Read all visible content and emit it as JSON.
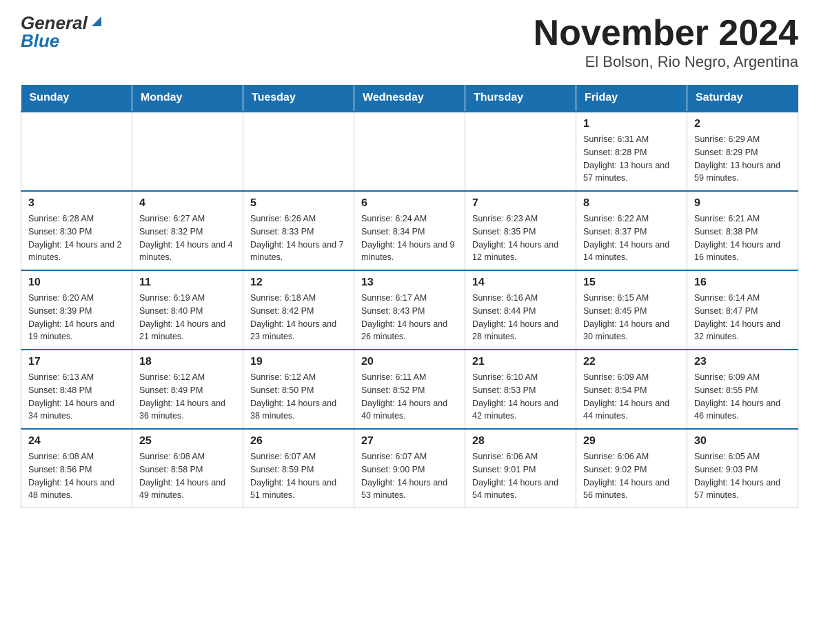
{
  "header": {
    "logo_line1": "General",
    "logo_line2": "Blue",
    "title": "November 2024",
    "subtitle": "El Bolson, Rio Negro, Argentina"
  },
  "days_of_week": [
    "Sunday",
    "Monday",
    "Tuesday",
    "Wednesday",
    "Thursday",
    "Friday",
    "Saturday"
  ],
  "weeks": [
    [
      {
        "day": "",
        "info": ""
      },
      {
        "day": "",
        "info": ""
      },
      {
        "day": "",
        "info": ""
      },
      {
        "day": "",
        "info": ""
      },
      {
        "day": "",
        "info": ""
      },
      {
        "day": "1",
        "info": "Sunrise: 6:31 AM\nSunset: 8:28 PM\nDaylight: 13 hours and 57 minutes."
      },
      {
        "day": "2",
        "info": "Sunrise: 6:29 AM\nSunset: 8:29 PM\nDaylight: 13 hours and 59 minutes."
      }
    ],
    [
      {
        "day": "3",
        "info": "Sunrise: 6:28 AM\nSunset: 8:30 PM\nDaylight: 14 hours and 2 minutes."
      },
      {
        "day": "4",
        "info": "Sunrise: 6:27 AM\nSunset: 8:32 PM\nDaylight: 14 hours and 4 minutes."
      },
      {
        "day": "5",
        "info": "Sunrise: 6:26 AM\nSunset: 8:33 PM\nDaylight: 14 hours and 7 minutes."
      },
      {
        "day": "6",
        "info": "Sunrise: 6:24 AM\nSunset: 8:34 PM\nDaylight: 14 hours and 9 minutes."
      },
      {
        "day": "7",
        "info": "Sunrise: 6:23 AM\nSunset: 8:35 PM\nDaylight: 14 hours and 12 minutes."
      },
      {
        "day": "8",
        "info": "Sunrise: 6:22 AM\nSunset: 8:37 PM\nDaylight: 14 hours and 14 minutes."
      },
      {
        "day": "9",
        "info": "Sunrise: 6:21 AM\nSunset: 8:38 PM\nDaylight: 14 hours and 16 minutes."
      }
    ],
    [
      {
        "day": "10",
        "info": "Sunrise: 6:20 AM\nSunset: 8:39 PM\nDaylight: 14 hours and 19 minutes."
      },
      {
        "day": "11",
        "info": "Sunrise: 6:19 AM\nSunset: 8:40 PM\nDaylight: 14 hours and 21 minutes."
      },
      {
        "day": "12",
        "info": "Sunrise: 6:18 AM\nSunset: 8:42 PM\nDaylight: 14 hours and 23 minutes."
      },
      {
        "day": "13",
        "info": "Sunrise: 6:17 AM\nSunset: 8:43 PM\nDaylight: 14 hours and 26 minutes."
      },
      {
        "day": "14",
        "info": "Sunrise: 6:16 AM\nSunset: 8:44 PM\nDaylight: 14 hours and 28 minutes."
      },
      {
        "day": "15",
        "info": "Sunrise: 6:15 AM\nSunset: 8:45 PM\nDaylight: 14 hours and 30 minutes."
      },
      {
        "day": "16",
        "info": "Sunrise: 6:14 AM\nSunset: 8:47 PM\nDaylight: 14 hours and 32 minutes."
      }
    ],
    [
      {
        "day": "17",
        "info": "Sunrise: 6:13 AM\nSunset: 8:48 PM\nDaylight: 14 hours and 34 minutes."
      },
      {
        "day": "18",
        "info": "Sunrise: 6:12 AM\nSunset: 8:49 PM\nDaylight: 14 hours and 36 minutes."
      },
      {
        "day": "19",
        "info": "Sunrise: 6:12 AM\nSunset: 8:50 PM\nDaylight: 14 hours and 38 minutes."
      },
      {
        "day": "20",
        "info": "Sunrise: 6:11 AM\nSunset: 8:52 PM\nDaylight: 14 hours and 40 minutes."
      },
      {
        "day": "21",
        "info": "Sunrise: 6:10 AM\nSunset: 8:53 PM\nDaylight: 14 hours and 42 minutes."
      },
      {
        "day": "22",
        "info": "Sunrise: 6:09 AM\nSunset: 8:54 PM\nDaylight: 14 hours and 44 minutes."
      },
      {
        "day": "23",
        "info": "Sunrise: 6:09 AM\nSunset: 8:55 PM\nDaylight: 14 hours and 46 minutes."
      }
    ],
    [
      {
        "day": "24",
        "info": "Sunrise: 6:08 AM\nSunset: 8:56 PM\nDaylight: 14 hours and 48 minutes."
      },
      {
        "day": "25",
        "info": "Sunrise: 6:08 AM\nSunset: 8:58 PM\nDaylight: 14 hours and 49 minutes."
      },
      {
        "day": "26",
        "info": "Sunrise: 6:07 AM\nSunset: 8:59 PM\nDaylight: 14 hours and 51 minutes."
      },
      {
        "day": "27",
        "info": "Sunrise: 6:07 AM\nSunset: 9:00 PM\nDaylight: 14 hours and 53 minutes."
      },
      {
        "day": "28",
        "info": "Sunrise: 6:06 AM\nSunset: 9:01 PM\nDaylight: 14 hours and 54 minutes."
      },
      {
        "day": "29",
        "info": "Sunrise: 6:06 AM\nSunset: 9:02 PM\nDaylight: 14 hours and 56 minutes."
      },
      {
        "day": "30",
        "info": "Sunrise: 6:05 AM\nSunset: 9:03 PM\nDaylight: 14 hours and 57 minutes."
      }
    ]
  ],
  "colors": {
    "header_bg": "#1a6faf",
    "header_text": "#ffffff",
    "border": "#cccccc",
    "accent": "#1a6faf"
  }
}
